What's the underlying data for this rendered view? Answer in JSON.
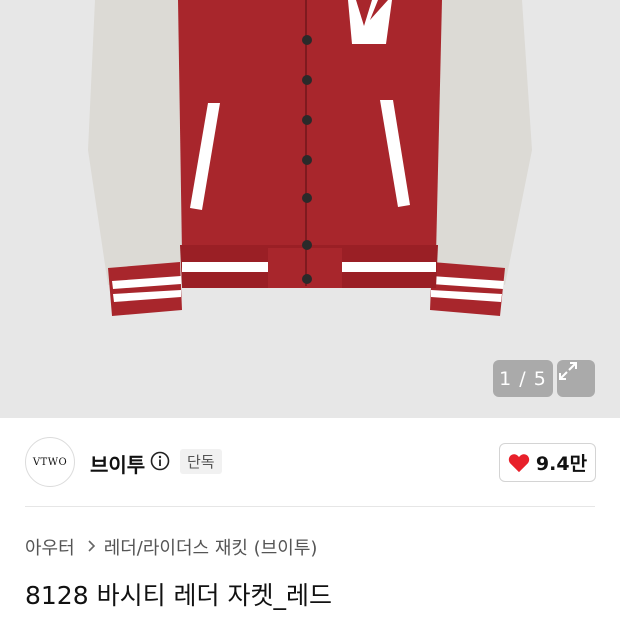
{
  "gallery": {
    "current": 1,
    "total": 5,
    "counter_text": "1 / 5",
    "expand_icon": "expand-arrows-icon",
    "background": "#e7e7e7"
  },
  "brand": {
    "logo_text": "VTWO",
    "name": "브이투",
    "info_icon": "info-circle-icon",
    "badge": "단독"
  },
  "like": {
    "icon": "heart-icon",
    "count": "9.4만",
    "color": "#e8202a"
  },
  "breadcrumb": {
    "items": [
      "아우터",
      "레더/라이더스 재킷 (브이투)"
    ],
    "separator_icon": "chevron-right-icon"
  },
  "product": {
    "title": "8128 바시티 레더 자켓_레드"
  },
  "colors": {
    "jacket_body": "#a8262c",
    "sleeves": "#dcdad5",
    "stripe": "#ffffff"
  }
}
